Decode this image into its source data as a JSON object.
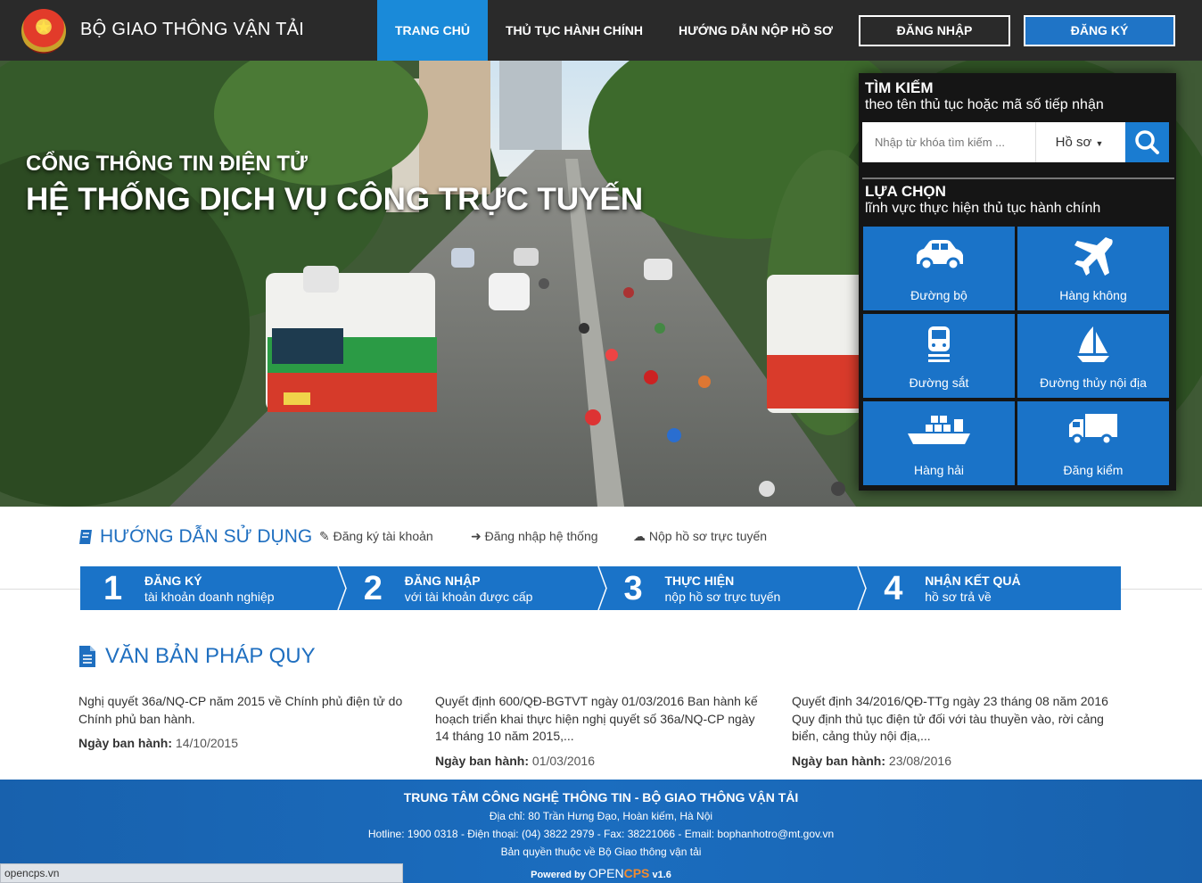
{
  "header": {
    "brand": "BỘ GIAO THÔNG VẬN TẢI",
    "nav": [
      "TRANG CHỦ",
      "THỦ TỤC HÀNH CHÍNH",
      "HƯỚNG DẪN NỘP HỒ SƠ"
    ],
    "login": "ĐĂNG NHẬP",
    "register": "ĐĂNG KÝ"
  },
  "hero": {
    "subtitle": "CỔNG THÔNG TIN ĐIỆN TỬ",
    "title": "HỆ THỐNG DỊCH VỤ CÔNG TRỰC TUYẾN"
  },
  "search": {
    "heading": "TÌM KIẾM",
    "subheading": "theo tên thủ tục hoặc mã số tiếp nhận",
    "placeholder": "Nhập từ khóa tìm kiếm ...",
    "type": "Hồ sơ"
  },
  "categories": {
    "heading": "LỰA CHỌN",
    "subheading": "lĩnh vực thực hiện thủ tục hành chính",
    "items": [
      {
        "label": "Đường bộ",
        "icon": "car-icon"
      },
      {
        "label": "Hàng không",
        "icon": "airplane-icon"
      },
      {
        "label": "Đường sắt",
        "icon": "train-icon"
      },
      {
        "label": "Đường thủy nội địa",
        "icon": "sailboat-icon"
      },
      {
        "label": "Hàng hải",
        "icon": "cargo-ship-icon"
      },
      {
        "label": "Đăng kiểm",
        "icon": "truck-icon"
      }
    ]
  },
  "guide": {
    "title": "HƯỚNG DẪN SỬ DỤNG",
    "links": [
      "Đăng ký tài khoản",
      "Đăng nhập hệ thống",
      "Nộp hồ sơ trực tuyến"
    ],
    "steps": [
      {
        "num": "1",
        "title": "ĐĂNG KÝ",
        "desc": "tài khoản doanh nghiệp"
      },
      {
        "num": "2",
        "title": "ĐĂNG NHẬP",
        "desc": "với tài khoản được cấp"
      },
      {
        "num": "3",
        "title": "THỰC HIỆN",
        "desc": "nộp hồ sơ trực tuyến"
      },
      {
        "num": "4",
        "title": "NHẬN KẾT QUẢ",
        "desc": "hồ sơ trả về"
      }
    ]
  },
  "documents": {
    "title": "VĂN BẢN PHÁP QUY",
    "date_label": "Ngày ban hành:",
    "items": [
      {
        "title": "Nghị quyết 36a/NQ-CP năm 2015 về Chính phủ điện tử do Chính phủ ban hành.",
        "date": "14/10/2015"
      },
      {
        "title": "Quyết định 600/QĐ-BGTVT ngày 01/03/2016 Ban hành kế hoạch triển khai thực hiện nghị quyết số 36a/NQ-CP ngày 14 tháng 10 năm 2015,...",
        "date": "01/03/2016"
      },
      {
        "title": "Quyết định 34/2016/QĐ-TTg ngày 23 tháng 08 năm 2016 Quy định thủ tục điện tử đối với tàu thuyền vào, rời cảng biển, cảng thủy nội địa,...",
        "date": "23/08/2016"
      }
    ]
  },
  "footer": {
    "org": "TRUNG TÂM CÔNG NGHỆ THÔNG TIN - BỘ GIAO THÔNG VẬN TẢI",
    "address": "Địa chỉ: 80 Trần Hưng Đạo, Hoàn kiếm, Hà Nội",
    "contact": "Hotline: 1900 0318 - Điện thoại: (04) 3822 2979 - Fax: 38221066 - Email: bophanhotro@mt.gov.vn",
    "copyright": "Bản quyền thuộc về Bộ Giao thông vận tải",
    "powered": "Powered by",
    "brand_open": "OPEN",
    "brand_cps": "CPS",
    "version": "v1.6"
  },
  "statusbar": {
    "url": "opencps.vn"
  },
  "colors": {
    "primary": "#1a73c8",
    "nav_active": "#1a8ad9",
    "topbar": "#2a2a2a",
    "heading": "#1f6fc0"
  }
}
